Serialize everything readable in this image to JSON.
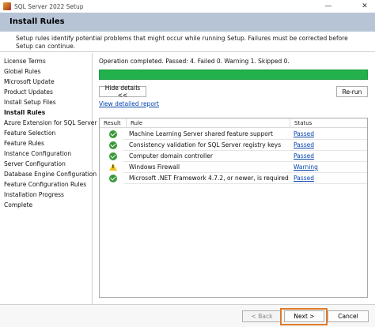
{
  "window": {
    "title": "SQL Server 2022 Setup",
    "minimize": "—",
    "close": "✕"
  },
  "header": {
    "title": "Install Rules",
    "description": "Setup rules identify potential problems that might occur while running Setup. Failures must be corrected before Setup can continue."
  },
  "sidebar": {
    "items": [
      {
        "label": "License Terms"
      },
      {
        "label": "Global Rules"
      },
      {
        "label": "Microsoft Update"
      },
      {
        "label": "Product Updates"
      },
      {
        "label": "Install Setup Files"
      },
      {
        "label": "Install Rules"
      },
      {
        "label": "Azure Extension for SQL Server"
      },
      {
        "label": "Feature Selection"
      },
      {
        "label": "Feature Rules"
      },
      {
        "label": "Instance Configuration"
      },
      {
        "label": "Server Configuration"
      },
      {
        "label": "Database Engine Configuration"
      },
      {
        "label": "Feature Configuration Rules"
      },
      {
        "label": "Installation Progress"
      },
      {
        "label": "Complete"
      }
    ],
    "active_index": 5
  },
  "main": {
    "status_text": "Operation completed. Passed: 4.   Failed 0.   Warning 1.   Skipped 0.",
    "progress_fraction": 1.0,
    "progress_color": "#22b14c",
    "hide_details_label": "Hide details <<",
    "rerun_label": "Re-run",
    "view_report_label": "View detailed report",
    "grid": {
      "headers": {
        "result": "Result",
        "rule": "Rule",
        "status": "Status"
      },
      "rows": [
        {
          "icon": "pass",
          "rule": "Machine Learning Server shared feature support",
          "status": "Passed"
        },
        {
          "icon": "pass",
          "rule": "Consistency validation for SQL Server registry keys",
          "status": "Passed"
        },
        {
          "icon": "pass",
          "rule": "Computer domain controller",
          "status": "Passed"
        },
        {
          "icon": "warning",
          "rule": "Windows Firewall",
          "status": "Warning"
        },
        {
          "icon": "pass",
          "rule": "Microsoft .NET Framework 4.7.2, or newer, is required",
          "status": "Passed"
        }
      ]
    }
  },
  "footer": {
    "back_label": "< Back",
    "next_label": "Next >",
    "cancel_label": "Cancel",
    "highlight_color": "#e07b2a"
  }
}
